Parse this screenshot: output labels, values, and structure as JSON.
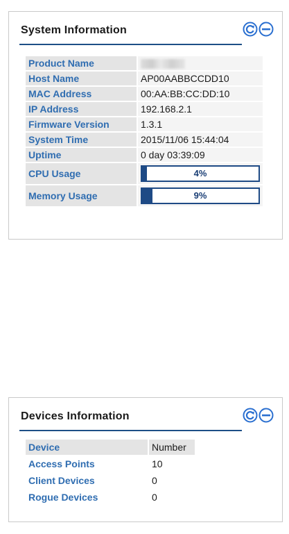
{
  "system_info": {
    "title": "System Information",
    "rows": [
      {
        "label": "Product Name",
        "value": ""
      },
      {
        "label": "Host Name",
        "value": "AP00AABBCCDD10"
      },
      {
        "label": "MAC Address",
        "value": "00:AA:BB:CC:DD:10"
      },
      {
        "label": "IP Address",
        "value": "192.168.2.1"
      },
      {
        "label": "Firmware Version",
        "value": "1.3.1"
      },
      {
        "label": "System Time",
        "value": "2015/11/06 15:44:04"
      },
      {
        "label": "Uptime",
        "value": "0 day 03:39:09"
      }
    ],
    "cpu": {
      "label": "CPU Usage",
      "percent": 4,
      "text": "4%"
    },
    "memory": {
      "label": "Memory Usage",
      "percent": 9,
      "text": "9%"
    }
  },
  "devices_info": {
    "title": "Devices Information",
    "header": {
      "device": "Device",
      "number": "Number"
    },
    "rows": [
      {
        "label": "Access Points",
        "value": "10"
      },
      {
        "label": "Client Devices",
        "value": "0"
      },
      {
        "label": "Rogue Devices",
        "value": "0"
      }
    ]
  },
  "colors": {
    "accent": "#2f6db1",
    "bar": "#1e4a85",
    "icon": "#2a6fd0"
  },
  "icons": {
    "refresh": "refresh-icon",
    "collapse": "collapse-minus-icon"
  }
}
